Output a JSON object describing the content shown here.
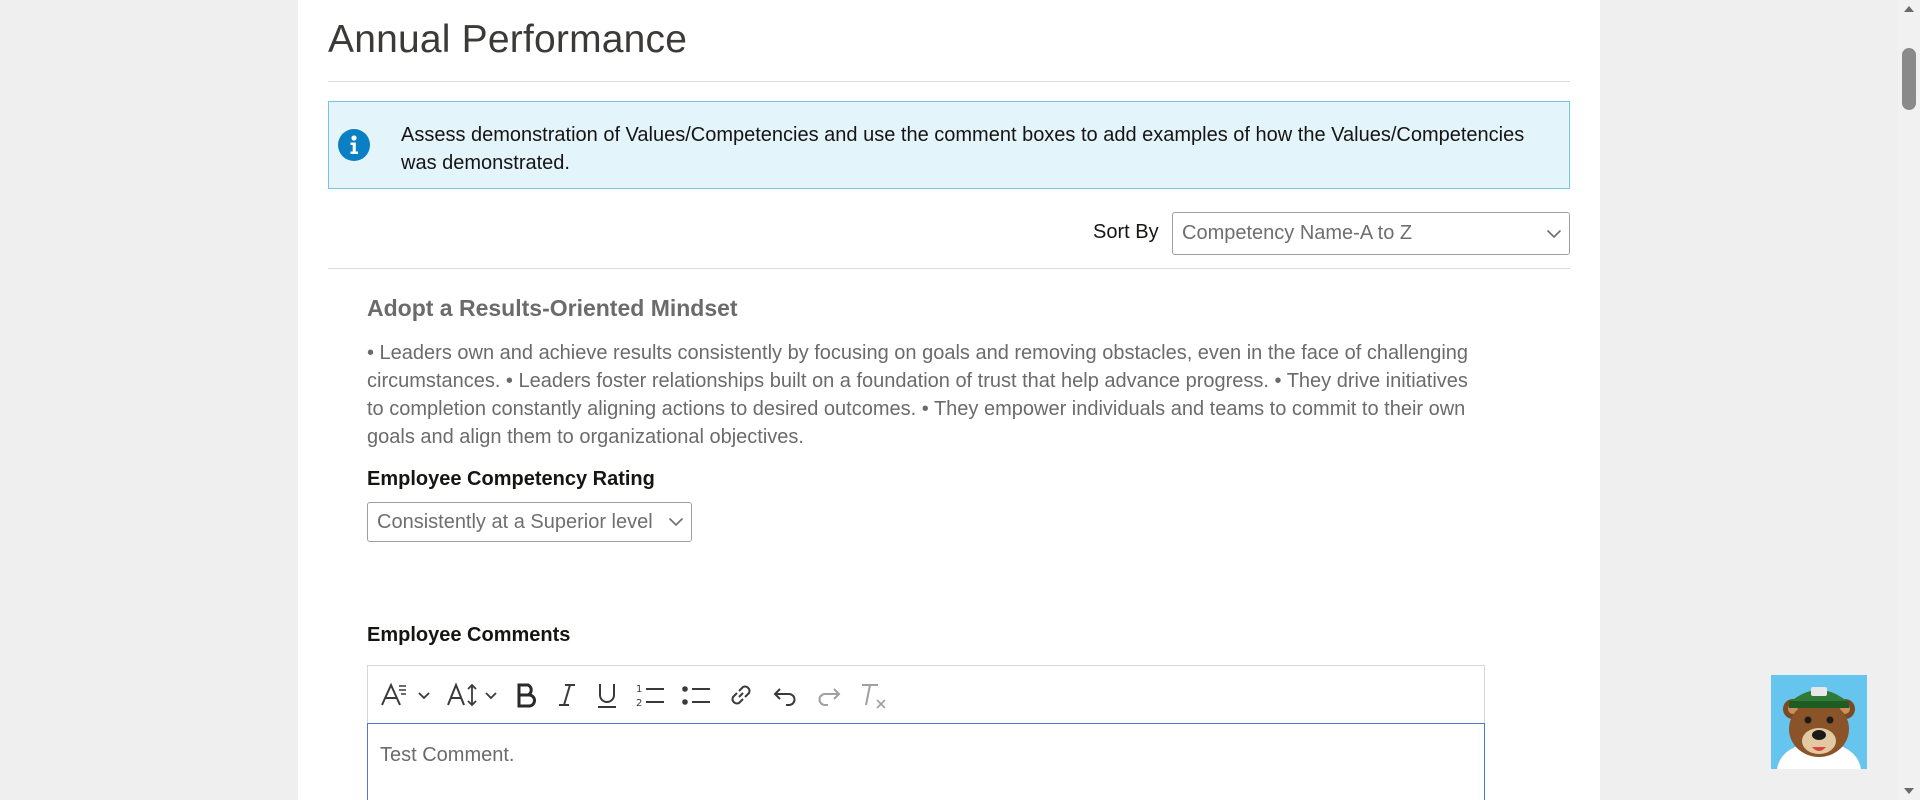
{
  "page": {
    "title": "Annual Performance"
  },
  "info": {
    "text": "Assess demonstration of Values/Competencies and use the comment boxes to add examples of how the Values/Competencies was demonstrated.",
    "icon": "info-icon"
  },
  "sort": {
    "label": "Sort By",
    "selected": "Competency Name-A to Z"
  },
  "competency": {
    "name": "Adopt a Results-Oriented Mindset",
    "description": "• Leaders own and achieve results consistently by focusing on goals and removing obstacles, even in the face of challenging circumstances. • Leaders foster relationships built on a foundation of trust that help advance progress. • They drive initiatives to completion constantly aligning actions to desired outcomes. • They empower individuals and teams to commit to their own goals and align them to organizational objectives.",
    "rating_label": "Employee Competency Rating",
    "rating_selected": "Consistently at a Superior level",
    "comments_label": "Employee Comments",
    "comment_value": "Test Comment."
  },
  "toolbar": {
    "buttons": [
      "font-family-icon",
      "font-size-icon",
      "bold-icon",
      "italic-icon",
      "underline-icon",
      "numbered-list-icon",
      "bulleted-list-icon",
      "link-icon",
      "undo-icon",
      "redo-icon",
      "clear-formatting-icon"
    ]
  },
  "colors": {
    "info_background": "#e4f4fb",
    "info_border": "#74c7e0",
    "info_icon": "#0b7fc3",
    "editor_focus_border": "#4a78d8",
    "mascot_background": "#66c5ee"
  }
}
